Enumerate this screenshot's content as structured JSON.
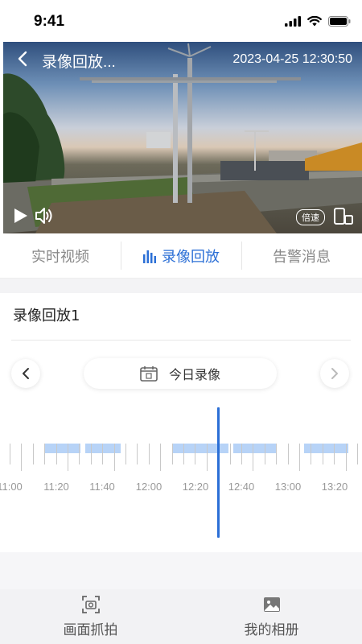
{
  "status_bar": {
    "time": "9:41"
  },
  "video": {
    "title": "录像回放...",
    "timestamp": "2023-04-25 12:30:50",
    "speed_label": "倍速"
  },
  "tabs": [
    {
      "label": "实时视频",
      "active": false
    },
    {
      "label": "录像回放",
      "active": true
    },
    {
      "label": "告警消息",
      "active": false
    }
  ],
  "section": {
    "title": "录像回放1"
  },
  "date_selector": {
    "label": "今日录像"
  },
  "timeline": {
    "labels": [
      "11:00",
      "11:20",
      "11:40",
      "12:00",
      "12:20",
      "12:40",
      "13:00",
      "13:20"
    ],
    "current_time": "12:30:50"
  },
  "bottom_bar": {
    "items": [
      {
        "label": "画面抓拍",
        "icon": "camera-capture-icon"
      },
      {
        "label": "我的相册",
        "icon": "album-icon"
      }
    ]
  },
  "colors": {
    "accent": "#2b6fd6",
    "segment": "#b7d3f7"
  }
}
